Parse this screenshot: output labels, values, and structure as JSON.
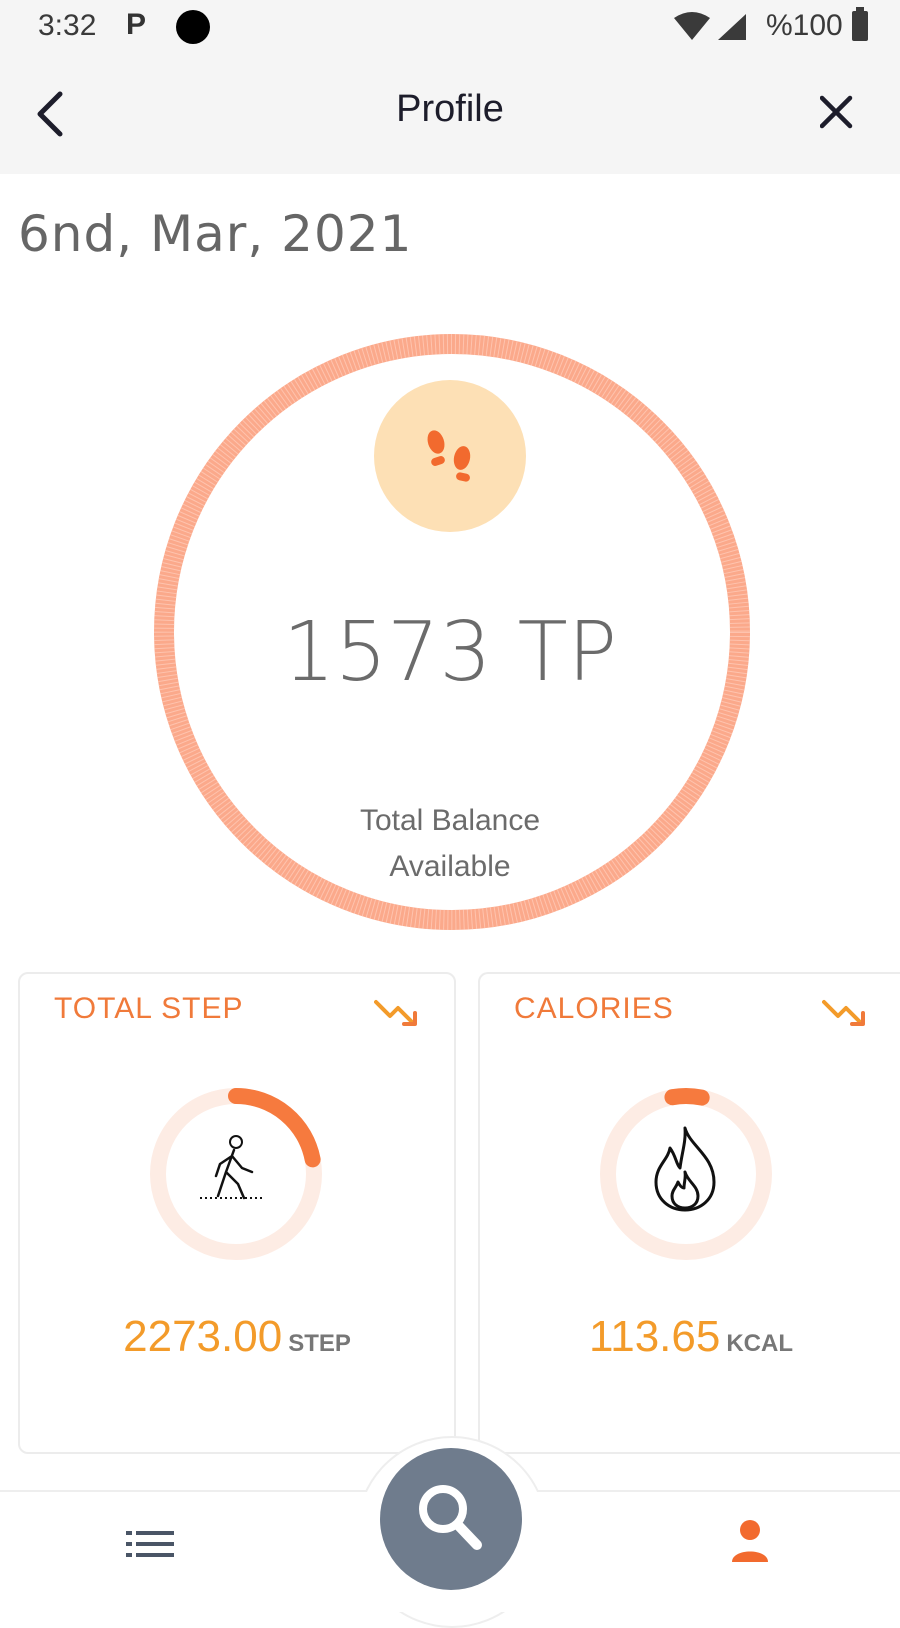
{
  "status_bar": {
    "time": "3:32",
    "app_indicator": "P",
    "battery_text": "%100",
    "icons": [
      "wifi-icon",
      "signal-icon",
      "battery-icon"
    ]
  },
  "header": {
    "title": "Profile",
    "back_icon": "chevron-left-icon",
    "close_icon": "close-icon"
  },
  "date": "6nd, Mar, 2021",
  "balance": {
    "value": "1573 TP",
    "label_line1": "Total Balance",
    "label_line2": "Available",
    "icon": "footsteps-icon"
  },
  "cards": {
    "steps": {
      "title": "TOTAL STEP",
      "value": "2273.00",
      "unit": "STEP",
      "icon": "walking-person-icon",
      "trend_icon": "trend-down-icon",
      "progress_fraction": 0.22
    },
    "calories": {
      "title": "CALORIES",
      "value": "113.65",
      "unit": "KCAL",
      "icon": "flame-icon",
      "trend_icon": "trend-down-icon",
      "progress_fraction": 0.06
    }
  },
  "bottom_nav": {
    "items": [
      "list-icon",
      "search-icon",
      "profile-icon"
    ]
  },
  "colors": {
    "accent_orange": "#f07a3a",
    "value_orange": "#f39b2a",
    "ring_peach": "#fba98b",
    "icon_circle": "#fde0b5",
    "fab_gray": "#6f7c8d"
  }
}
